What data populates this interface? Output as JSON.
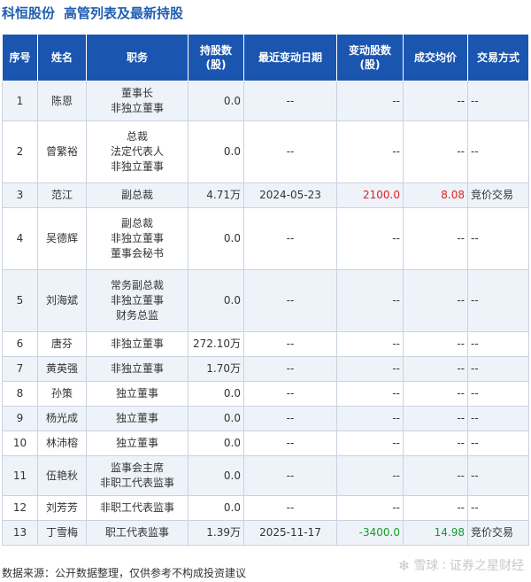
{
  "title": {
    "company": "科恒股份",
    "subtitle": "高管列表及最新持股"
  },
  "headers": [
    "序号",
    "姓名",
    "职务",
    "持股数\n(股)",
    "最近变动日期",
    "变动股数\n(股)",
    "成交均价",
    "交易方式"
  ],
  "rows": [
    {
      "no": "1",
      "name": "陈恩",
      "roles": [
        "董事长",
        "非独立董事"
      ],
      "shares": "0.0",
      "date": "--",
      "change": "--",
      "price": "--",
      "method": "--"
    },
    {
      "no": "2",
      "name": "曾繁裕",
      "roles": [
        "总裁",
        "法定代表人",
        "非独立董事"
      ],
      "shares": "0.0",
      "date": "--",
      "change": "--",
      "price": "--",
      "method": "--"
    },
    {
      "no": "3",
      "name": "范江",
      "roles": [
        "副总裁"
      ],
      "shares": "4.71万",
      "date": "2024-05-23",
      "change": "2100.0",
      "change_color": "red",
      "price": "8.08",
      "method": "竞价交易"
    },
    {
      "no": "4",
      "name": "吴德辉",
      "roles": [
        "副总裁",
        "非独立董事",
        "董事会秘书"
      ],
      "shares": "0.0",
      "date": "--",
      "change": "--",
      "price": "--",
      "method": "--"
    },
    {
      "no": "5",
      "name": "刘海斌",
      "roles": [
        "常务副总裁",
        "非独立董事",
        "财务总监"
      ],
      "shares": "0.0",
      "date": "--",
      "change": "--",
      "price": "--",
      "method": "--"
    },
    {
      "no": "6",
      "name": "唐芬",
      "roles": [
        "非独立董事"
      ],
      "shares": "272.10万",
      "date": "--",
      "change": "--",
      "price": "--",
      "method": "--"
    },
    {
      "no": "7",
      "name": "黄英强",
      "roles": [
        "非独立董事"
      ],
      "shares": "1.70万",
      "date": "--",
      "change": "--",
      "price": "--",
      "method": "--"
    },
    {
      "no": "8",
      "name": "孙策",
      "roles": [
        "独立董事"
      ],
      "shares": "0.0",
      "date": "--",
      "change": "--",
      "price": "--",
      "method": "--"
    },
    {
      "no": "9",
      "name": "杨光成",
      "roles": [
        "独立董事"
      ],
      "shares": "0.0",
      "date": "--",
      "change": "--",
      "price": "--",
      "method": "--"
    },
    {
      "no": "10",
      "name": "林沛榕",
      "roles": [
        "独立董事"
      ],
      "shares": "0.0",
      "date": "--",
      "change": "--",
      "price": "--",
      "method": "--"
    },
    {
      "no": "11",
      "name": "伍艳秋",
      "roles": [
        "监事会主席",
        "非职工代表监事"
      ],
      "shares": "0.0",
      "date": "--",
      "change": "--",
      "price": "--",
      "method": "--"
    },
    {
      "no": "12",
      "name": "刘芳芳",
      "roles": [
        "非职工代表监事"
      ],
      "shares": "0.0",
      "date": "--",
      "change": "--",
      "price": "--",
      "method": "--"
    },
    {
      "no": "13",
      "name": "丁雪梅",
      "roles": [
        "职工代表监事"
      ],
      "shares": "1.39万",
      "date": "2025-11-17",
      "change": "-3400.0",
      "change_color": "green",
      "price": "14.98",
      "method": "竞价交易"
    }
  ],
  "footer": "数据来源：公开数据整理，仅供参考不构成投资建议",
  "brand": {
    "snowball": "雪球",
    "name": "证券之星财经"
  }
}
